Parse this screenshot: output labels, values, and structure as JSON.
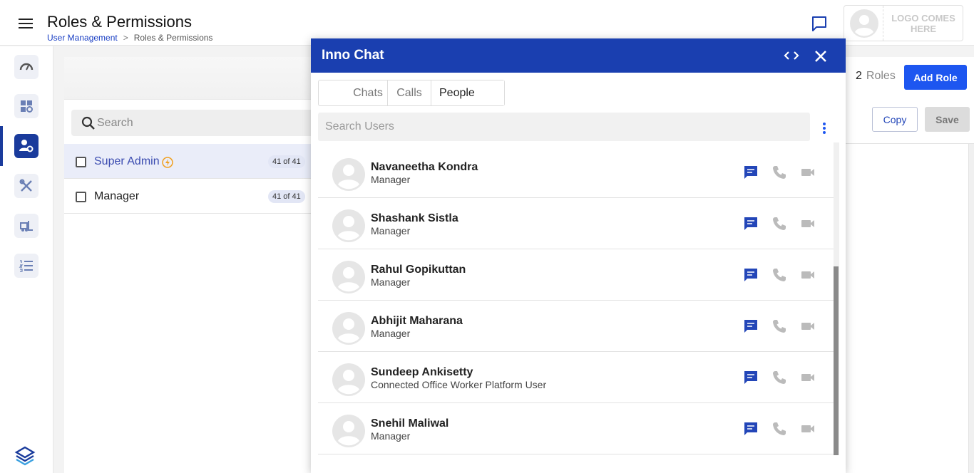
{
  "header": {
    "title": "Roles & Permissions",
    "breadcrumb": [
      "User Management",
      ">",
      "Roles & Permissions"
    ],
    "logo_text": "LOGO COMES HERE"
  },
  "sidebar": {
    "items": [
      {
        "icon": "speedometer-icon"
      },
      {
        "icon": "dashboard-settings-icon"
      },
      {
        "icon": "user-settings-icon",
        "active": true
      },
      {
        "icon": "tools-icon"
      },
      {
        "icon": "forklift-icon"
      },
      {
        "icon": "numbered-list-icon"
      }
    ]
  },
  "roles_panel": {
    "search_placeholder": "Search",
    "roles": [
      {
        "name": "Super Admin",
        "count": "41 of 41",
        "selected": true
      },
      {
        "name": "Manager",
        "count": "41 of 41",
        "selected": false
      }
    ],
    "total_count": "2",
    "total_label": "Roles",
    "add_role_label": "Add Role",
    "copy_label": "Copy",
    "save_label": "Save"
  },
  "chat": {
    "title": "Inno Chat",
    "tabs": [
      "Chats",
      "Calls",
      "People"
    ],
    "active_tab": "People",
    "search_placeholder": "Search Users",
    "users": [
      {
        "name": "Navaneetha Kondra",
        "role": "Manager"
      },
      {
        "name": "Shashank Sistla",
        "role": "Manager"
      },
      {
        "name": "Rahul Gopikuttan",
        "role": "Manager"
      },
      {
        "name": "Abhijit Maharana",
        "role": "Manager"
      },
      {
        "name": "Sundeep Ankisetty",
        "role": "Connected Office Worker Platform User"
      },
      {
        "name": "Snehil Maliwal",
        "role": "Manager"
      }
    ]
  },
  "colors": {
    "primary": "#1a3fb0",
    "accent": "#1d56f0",
    "sidebar_active": "#1a3b9c",
    "bolt": "#f0a020"
  }
}
